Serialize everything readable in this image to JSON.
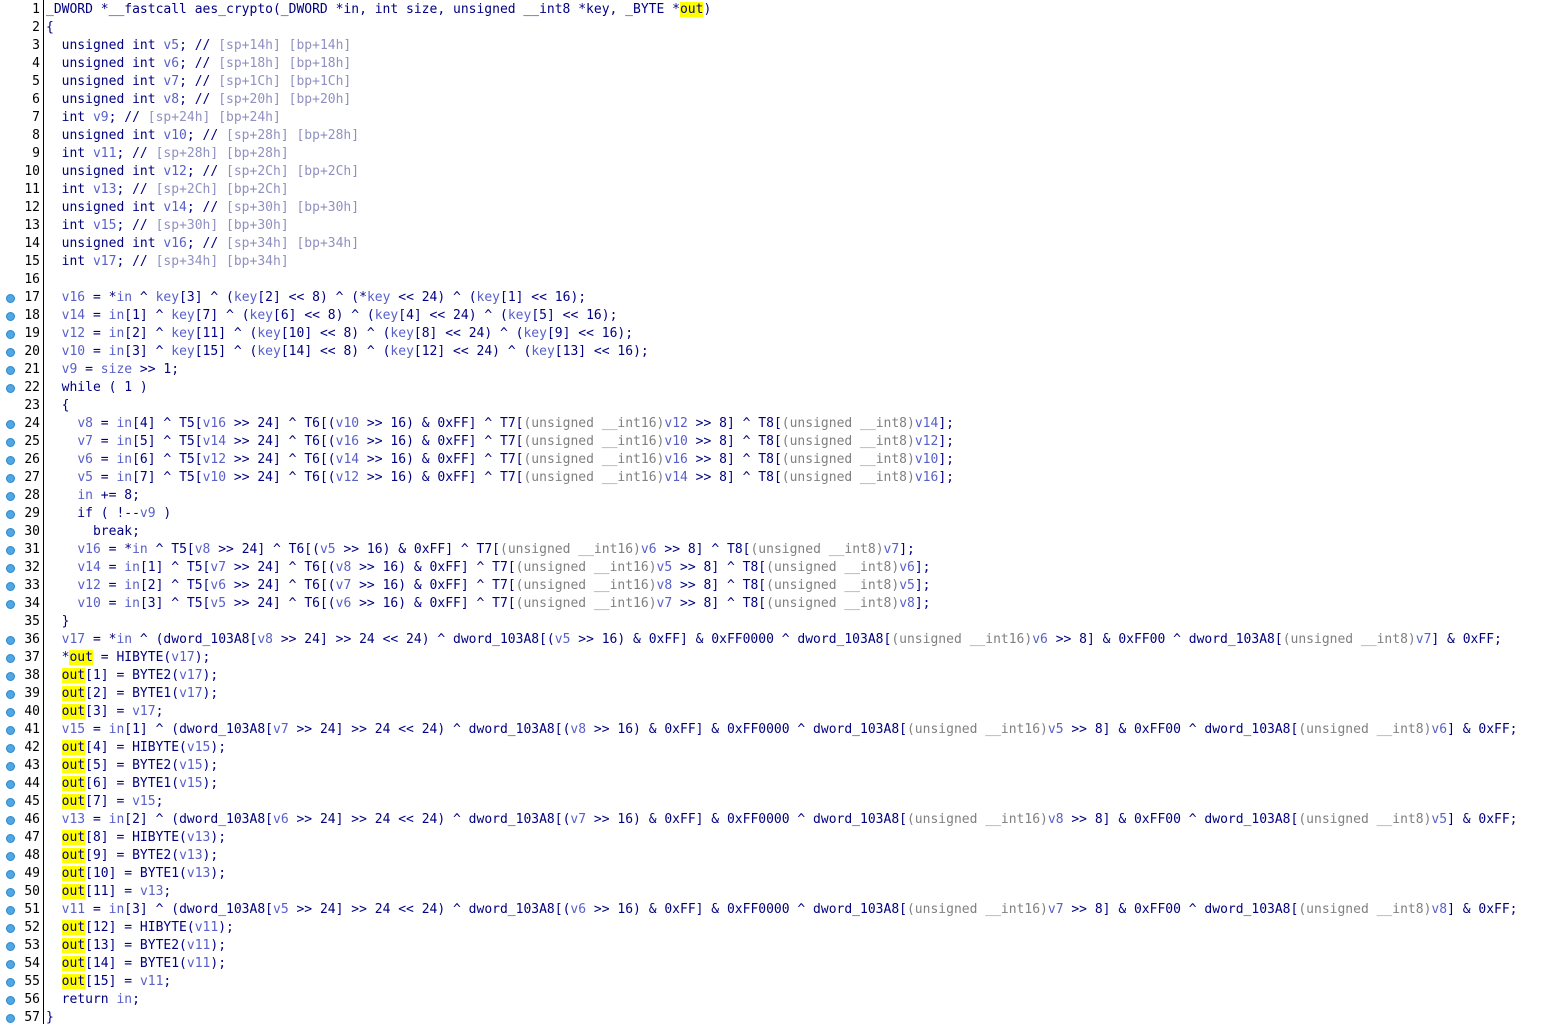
{
  "view": "Pseudocode",
  "lines": [
    {
      "n": "1",
      "bp": false,
      "text": "_DWORD *__fastcall aes_crypto(_DWORD *in, int size, unsigned __int8 *key, _BYTE *out)"
    },
    {
      "n": "2",
      "bp": false,
      "text": "{"
    },
    {
      "n": "3",
      "bp": false,
      "text": "  unsigned int v5; // [sp+14h] [bp+14h]"
    },
    {
      "n": "4",
      "bp": false,
      "text": "  unsigned int v6; // [sp+18h] [bp+18h]"
    },
    {
      "n": "5",
      "bp": false,
      "text": "  unsigned int v7; // [sp+1Ch] [bp+1Ch]"
    },
    {
      "n": "6",
      "bp": false,
      "text": "  unsigned int v8; // [sp+20h] [bp+20h]"
    },
    {
      "n": "7",
      "bp": false,
      "text": "  int v9; // [sp+24h] [bp+24h]"
    },
    {
      "n": "8",
      "bp": false,
      "text": "  unsigned int v10; // [sp+28h] [bp+28h]"
    },
    {
      "n": "9",
      "bp": false,
      "text": "  int v11; // [sp+28h] [bp+28h]"
    },
    {
      "n": "10",
      "bp": false,
      "text": "  unsigned int v12; // [sp+2Ch] [bp+2Ch]"
    },
    {
      "n": "11",
      "bp": false,
      "text": "  int v13; // [sp+2Ch] [bp+2Ch]"
    },
    {
      "n": "12",
      "bp": false,
      "text": "  unsigned int v14; // [sp+30h] [bp+30h]"
    },
    {
      "n": "13",
      "bp": false,
      "text": "  int v15; // [sp+30h] [bp+30h]"
    },
    {
      "n": "14",
      "bp": false,
      "text": "  unsigned int v16; // [sp+34h] [bp+34h]"
    },
    {
      "n": "15",
      "bp": false,
      "text": "  int v17; // [sp+34h] [bp+34h]"
    },
    {
      "n": "16",
      "bp": false,
      "text": ""
    },
    {
      "n": "17",
      "bp": true,
      "text": "  v16 = *in ^ key[3] ^ (key[2] << 8) ^ (*key << 24) ^ (key[1] << 16);"
    },
    {
      "n": "18",
      "bp": true,
      "text": "  v14 = in[1] ^ key[7] ^ (key[6] << 8) ^ (key[4] << 24) ^ (key[5] << 16);"
    },
    {
      "n": "19",
      "bp": true,
      "text": "  v12 = in[2] ^ key[11] ^ (key[10] << 8) ^ (key[8] << 24) ^ (key[9] << 16);"
    },
    {
      "n": "20",
      "bp": true,
      "text": "  v10 = in[3] ^ key[15] ^ (key[14] << 8) ^ (key[12] << 24) ^ (key[13] << 16);"
    },
    {
      "n": "21",
      "bp": true,
      "text": "  v9 = size >> 1;"
    },
    {
      "n": "22",
      "bp": true,
      "text": "  while ( 1 )"
    },
    {
      "n": "23",
      "bp": false,
      "text": "  {"
    },
    {
      "n": "24",
      "bp": true,
      "text": "    v8 = in[4] ^ T5[v16 >> 24] ^ T6[(v10 >> 16) & 0xFF] ^ T7[(unsigned __int16)v12 >> 8] ^ T8[(unsigned __int8)v14];"
    },
    {
      "n": "25",
      "bp": true,
      "text": "    v7 = in[5] ^ T5[v14 >> 24] ^ T6[(v16 >> 16) & 0xFF] ^ T7[(unsigned __int16)v10 >> 8] ^ T8[(unsigned __int8)v12];"
    },
    {
      "n": "26",
      "bp": true,
      "text": "    v6 = in[6] ^ T5[v12 >> 24] ^ T6[(v14 >> 16) & 0xFF] ^ T7[(unsigned __int16)v16 >> 8] ^ T8[(unsigned __int8)v10];"
    },
    {
      "n": "27",
      "bp": true,
      "text": "    v5 = in[7] ^ T5[v10 >> 24] ^ T6[(v12 >> 16) & 0xFF] ^ T7[(unsigned __int16)v14 >> 8] ^ T8[(unsigned __int8)v16];"
    },
    {
      "n": "28",
      "bp": true,
      "text": "    in += 8;"
    },
    {
      "n": "29",
      "bp": true,
      "text": "    if ( !--v9 )"
    },
    {
      "n": "30",
      "bp": true,
      "text": "      break;"
    },
    {
      "n": "31",
      "bp": true,
      "text": "    v16 = *in ^ T5[v8 >> 24] ^ T6[(v5 >> 16) & 0xFF] ^ T7[(unsigned __int16)v6 >> 8] ^ T8[(unsigned __int8)v7];"
    },
    {
      "n": "32",
      "bp": true,
      "text": "    v14 = in[1] ^ T5[v7 >> 24] ^ T6[(v8 >> 16) & 0xFF] ^ T7[(unsigned __int16)v5 >> 8] ^ T8[(unsigned __int8)v6];"
    },
    {
      "n": "33",
      "bp": true,
      "text": "    v12 = in[2] ^ T5[v6 >> 24] ^ T6[(v7 >> 16) & 0xFF] ^ T7[(unsigned __int16)v8 >> 8] ^ T8[(unsigned __int8)v5];"
    },
    {
      "n": "34",
      "bp": true,
      "text": "    v10 = in[3] ^ T5[v5 >> 24] ^ T6[(v6 >> 16) & 0xFF] ^ T7[(unsigned __int16)v7 >> 8] ^ T8[(unsigned __int8)v8];"
    },
    {
      "n": "35",
      "bp": false,
      "text": "  }"
    },
    {
      "n": "36",
      "bp": true,
      "text": "  v17 = *in ^ (dword_103A8[v8 >> 24] >> 24 << 24) ^ dword_103A8[(v5 >> 16) & 0xFF] & 0xFF0000 ^ dword_103A8[(unsigned __int16)v6 >> 8] & 0xFF00 ^ dword_103A8[(unsigned __int8)v7] & 0xFF;"
    },
    {
      "n": "37",
      "bp": true,
      "text": "  *out = HIBYTE(v17);"
    },
    {
      "n": "38",
      "bp": true,
      "text": "  out[1] = BYTE2(v17);"
    },
    {
      "n": "39",
      "bp": true,
      "text": "  out[2] = BYTE1(v17);"
    },
    {
      "n": "40",
      "bp": true,
      "text": "  out[3] = v17;"
    },
    {
      "n": "41",
      "bp": true,
      "text": "  v15 = in[1] ^ (dword_103A8[v7 >> 24] >> 24 << 24) ^ dword_103A8[(v8 >> 16) & 0xFF] & 0xFF0000 ^ dword_103A8[(unsigned __int16)v5 >> 8] & 0xFF00 ^ dword_103A8[(unsigned __int8)v6] & 0xFF;"
    },
    {
      "n": "42",
      "bp": true,
      "text": "  out[4] = HIBYTE(v15);"
    },
    {
      "n": "43",
      "bp": true,
      "text": "  out[5] = BYTE2(v15);"
    },
    {
      "n": "44",
      "bp": true,
      "text": "  out[6] = BYTE1(v15);"
    },
    {
      "n": "45",
      "bp": true,
      "text": "  out[7] = v15;"
    },
    {
      "n": "46",
      "bp": true,
      "text": "  v13 = in[2] ^ (dword_103A8[v6 >> 24] >> 24 << 24) ^ dword_103A8[(v7 >> 16) & 0xFF] & 0xFF0000 ^ dword_103A8[(unsigned __int16)v8 >> 8] & 0xFF00 ^ dword_103A8[(unsigned __int8)v5] & 0xFF;"
    },
    {
      "n": "47",
      "bp": true,
      "text": "  out[8] = HIBYTE(v13);"
    },
    {
      "n": "48",
      "bp": true,
      "text": "  out[9] = BYTE2(v13);"
    },
    {
      "n": "49",
      "bp": true,
      "text": "  out[10] = BYTE1(v13);"
    },
    {
      "n": "50",
      "bp": true,
      "text": "  out[11] = v13;"
    },
    {
      "n": "51",
      "bp": true,
      "text": "  v11 = in[3] ^ (dword_103A8[v5 >> 24] >> 24 << 24) ^ dword_103A8[(v6 >> 16) & 0xFF] & 0xFF0000 ^ dword_103A8[(unsigned __int16)v7 >> 8] & 0xFF00 ^ dword_103A8[(unsigned __int8)v8] & 0xFF;"
    },
    {
      "n": "52",
      "bp": true,
      "text": "  out[12] = HIBYTE(v11);"
    },
    {
      "n": "53",
      "bp": true,
      "text": "  out[13] = BYTE2(v11);"
    },
    {
      "n": "54",
      "bp": true,
      "text": "  out[14] = BYTE1(v11);"
    },
    {
      "n": "55",
      "bp": true,
      "text": "  out[15] = v11;"
    },
    {
      "n": "56",
      "bp": true,
      "text": "  return in;"
    },
    {
      "n": "57",
      "bp": true,
      "text": "}"
    }
  ],
  "highlight_word": "out",
  "colors": {
    "code": "#000080",
    "comment": "#9090c0",
    "variable": "#5860c8",
    "highlight": "#ffff00",
    "breakpoint_dot": "#4ea7e6"
  }
}
